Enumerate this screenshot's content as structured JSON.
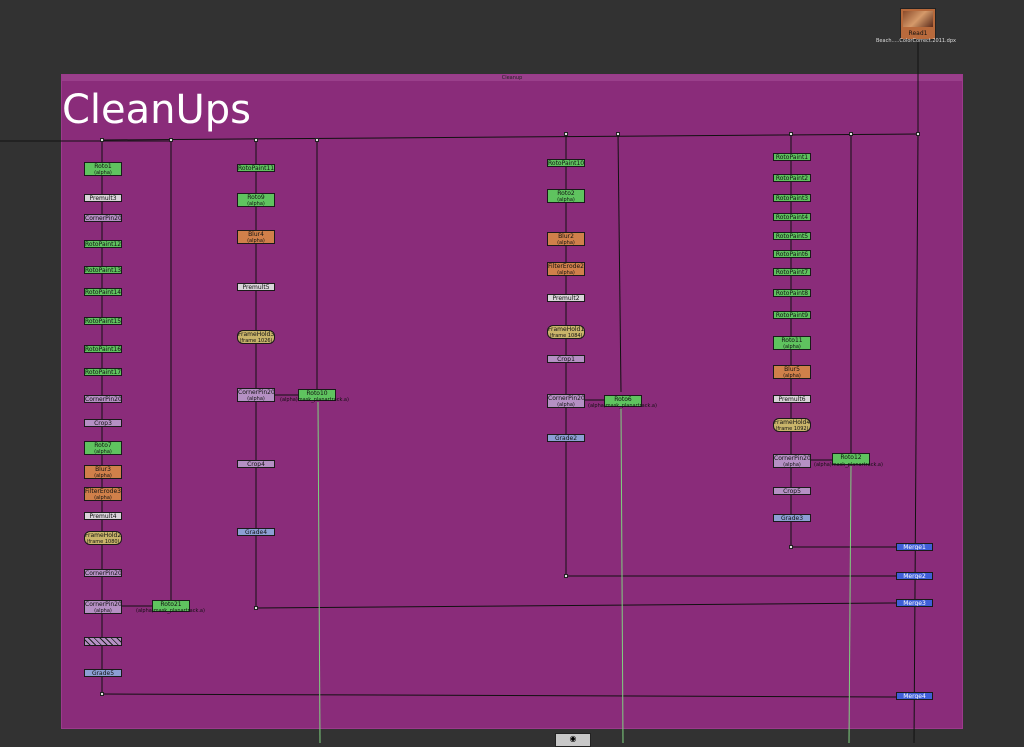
{
  "backdrop": {
    "label": "Cleanup",
    "title": "CleanUps"
  },
  "read_node": {
    "label": "Read1",
    "file": "Beach.....ColorCorrect.2011.dpx"
  },
  "viewer": {
    "icon": "viewer-icon"
  },
  "nodes": {
    "roto1": {
      "label": "Roto1",
      "sub": "(alpha)"
    },
    "premult3": {
      "label": "Premult3"
    },
    "cornerpin20": {
      "label": "CornerPin20"
    },
    "rotopaint12": {
      "label": "RotoPaint12"
    },
    "rotopaint13": {
      "label": "RotoPaint13"
    },
    "rotopaint14": {
      "label": "RotoPaint14"
    },
    "rotopaint15": {
      "label": "RotoPaint15"
    },
    "rotopaint16": {
      "label": "RotoPaint16"
    },
    "rotopaint17": {
      "label": "RotoPaint17"
    },
    "cornerpin201": {
      "label": "CornerPin20"
    },
    "crop3": {
      "label": "Crop3"
    },
    "roto7": {
      "label": "Roto7",
      "sub": "(alpha)"
    },
    "blur3": {
      "label": "Blur3",
      "sub": "(alpha)"
    },
    "filtererode3": {
      "label": "FilterErode3",
      "sub": "(alpha)"
    },
    "premult4": {
      "label": "Premult4"
    },
    "framehold2": {
      "label": "FrameHold2",
      "sub": "(frame 1080)"
    },
    "cornerpin202": {
      "label": "CornerPin20"
    },
    "cornerpin20c": {
      "label": "CornerPin20",
      "sub": "(alpha)"
    },
    "roto21": {
      "label": "Roto21",
      "ext": "(alpha)mask_planartrack.a)"
    },
    "disabled": {
      "label": ""
    },
    "grade5": {
      "label": "Grade5"
    },
    "rotopaint11": {
      "label": "RotoPaint11"
    },
    "roto9": {
      "label": "Roto9",
      "sub": "(alpha)"
    },
    "blur4": {
      "label": "Blur4",
      "sub": "(alpha)"
    },
    "premult5": {
      "label": "Premult5"
    },
    "framehold3": {
      "label": "FrameHold3",
      "sub": "(frame 1026)"
    },
    "cornerpin20b": {
      "label": "CornerPin20",
      "sub": "(alpha)"
    },
    "roto10": {
      "label": "Roto10",
      "ext": "(alpha)mask_planartrack.a)"
    },
    "crop4": {
      "label": "Crop4"
    },
    "grade4": {
      "label": "Grade4"
    },
    "rotopaint10": {
      "label": "RotoPaint10"
    },
    "roto2": {
      "label": "Roto2",
      "sub": "(alpha)"
    },
    "blur2": {
      "label": "Blur2",
      "sub": "(alpha)"
    },
    "filtererode2": {
      "label": "FilterErode2",
      "sub": "(alpha)"
    },
    "premult2": {
      "label": "Premult2"
    },
    "framehold1": {
      "label": "FrameHold1",
      "sub": "(frame 1084)"
    },
    "crop1": {
      "label": "Crop1"
    },
    "cornerpin20d": {
      "label": "CornerPin20",
      "sub": "(alpha)"
    },
    "roto6": {
      "label": "Roto6",
      "ext": "(alpha)mask_planartrack.a)"
    },
    "grade2": {
      "label": "Grade2"
    },
    "rp1": {
      "label": "RotoPaint1"
    },
    "rp2": {
      "label": "RotoPaint2"
    },
    "rp3": {
      "label": "RotoPaint3"
    },
    "rp4": {
      "label": "RotoPaint4"
    },
    "rp5": {
      "label": "RotoPaint5"
    },
    "rp6": {
      "label": "RotoPaint6"
    },
    "rp7": {
      "label": "RotoPaint7"
    },
    "rp8": {
      "label": "RotoPaint8"
    },
    "rp9": {
      "label": "RotoPaint9"
    },
    "roto11": {
      "label": "Roto11",
      "sub": "(alpha)"
    },
    "blur5": {
      "label": "Blur5",
      "sub": "(alpha)"
    },
    "premult6": {
      "label": "Premult6"
    },
    "framehold4": {
      "label": "FrameHold4",
      "sub": "(frame 1092)"
    },
    "cornerpin20e": {
      "label": "CornerPin20",
      "sub": "(alpha)"
    },
    "roto12": {
      "label": "Roto12",
      "ext": "(alpha)mask_planartrack.a)"
    },
    "crop5": {
      "label": "Crop5"
    },
    "grade3": {
      "label": "Grade3"
    },
    "merge1": {
      "label": "Merge1"
    },
    "merge2": {
      "label": "Merge2"
    },
    "merge3": {
      "label": "Merge3"
    },
    "merge4": {
      "label": "Merge4"
    }
  }
}
